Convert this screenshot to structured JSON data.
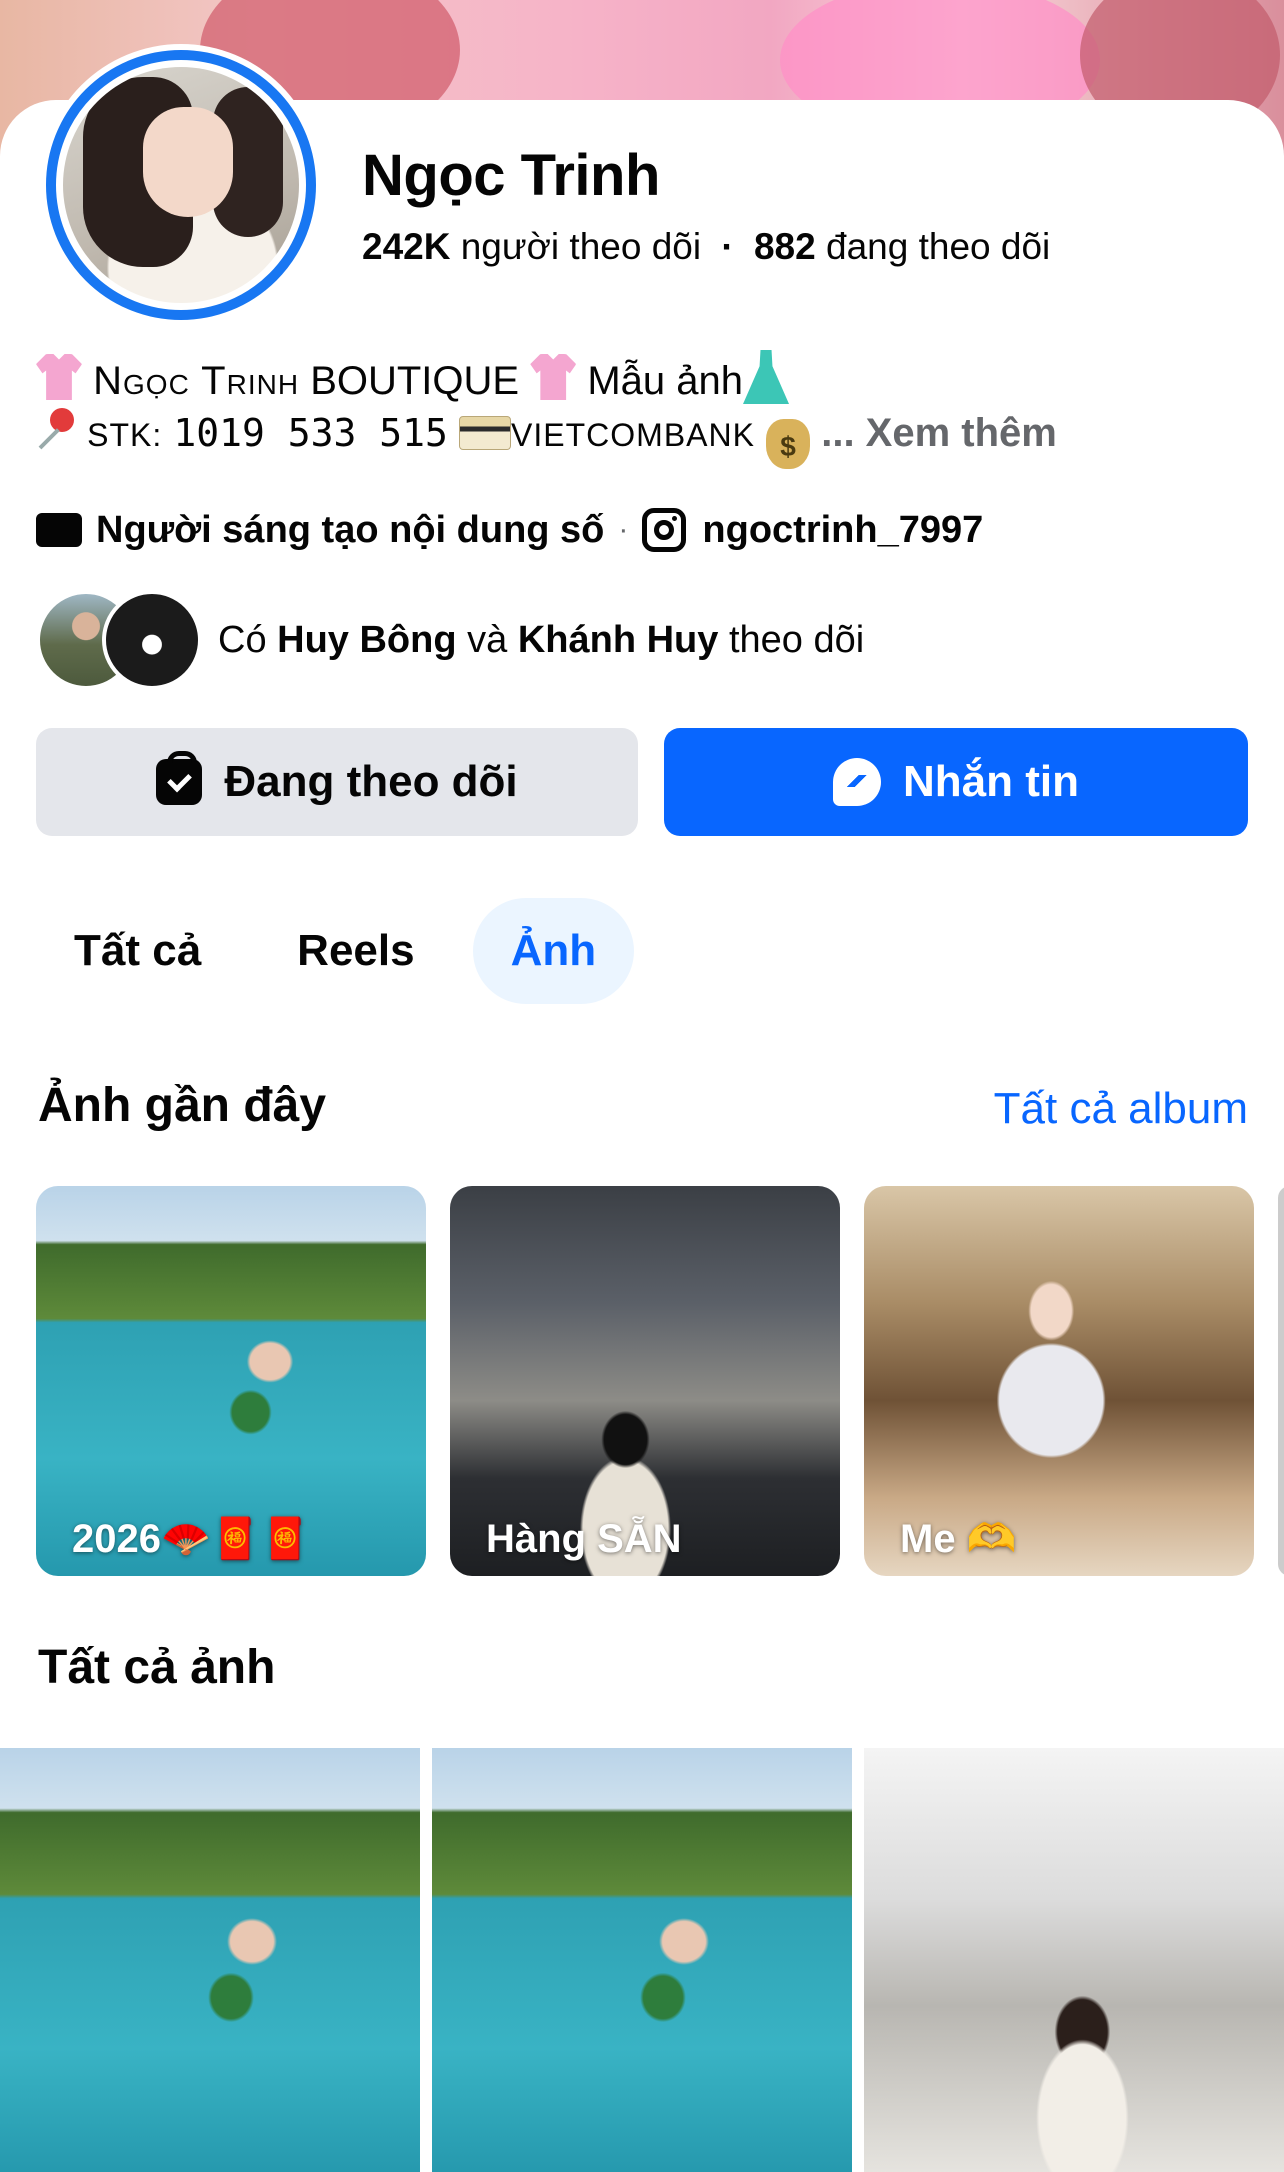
{
  "profile": {
    "name": "Ngọc Trinh",
    "followers_count": "242K",
    "followers_label": "người theo dõi",
    "following_count": "882",
    "following_label": "đang theo dõi"
  },
  "bio": {
    "line1_brand": "Ngọc Trinh",
    "line1_boutique": "BOUTIQUE",
    "line1_model": "Mẫu ảnh",
    "line2_stk_label": "STK:",
    "line2_stk_number": "1019 533 515",
    "line2_bank": "VIETCOMBANK",
    "see_more": "... Xem thêm"
  },
  "meta": {
    "creator_label": "Người sáng tạo nội dung số",
    "separator": "·",
    "instagram_handle": "ngoctrinh_7997"
  },
  "mutual": {
    "prefix": "Có",
    "friend1": "Huy Bông",
    "conj": "và",
    "friend2": "Khánh Huy",
    "suffix": "theo dõi"
  },
  "actions": {
    "following_label": "Đang theo dõi",
    "message_label": "Nhắn tin"
  },
  "tabs": [
    {
      "label": "Tất cả",
      "active": false
    },
    {
      "label": "Reels",
      "active": false
    },
    {
      "label": "Ảnh",
      "active": true
    }
  ],
  "recent_photos": {
    "title": "Ảnh gần đây",
    "all_albums_link": "Tất cả album",
    "albums": [
      {
        "label": "2026",
        "emoji": "🪭🧧🧧"
      },
      {
        "label": "Hàng SẴN",
        "emoji": ""
      },
      {
        "label": "Me",
        "emoji": "🫶"
      }
    ]
  },
  "all_photos": {
    "title": "Tất cả ảnh"
  },
  "colors": {
    "accent_blue": "#0866ff",
    "ring_blue": "#1877f2",
    "secondary_button": "#e4e6eb",
    "muted_text": "#65676b"
  }
}
